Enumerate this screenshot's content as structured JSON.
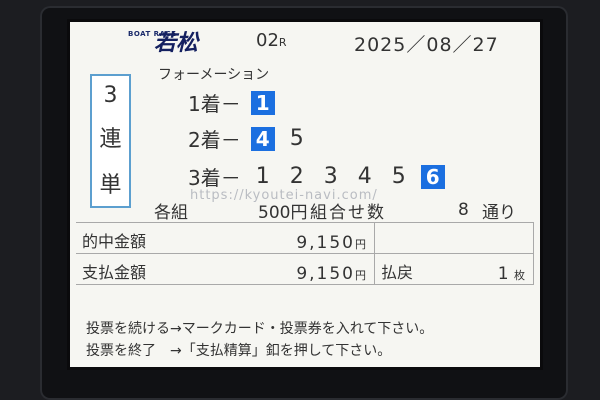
{
  "header": {
    "logo_small": "BOAT RACE",
    "venue": "若松",
    "race_no": "02",
    "race_suffix": "R",
    "date": "2025／08／27"
  },
  "bet": {
    "type_chars": [
      "3",
      "連",
      "単"
    ],
    "method": "フォーメーション",
    "first": {
      "label": "1着－",
      "selected": [
        "1"
      ],
      "plain": []
    },
    "second": {
      "label": "2着－",
      "selected": [
        "4"
      ],
      "plain": [
        "5"
      ]
    },
    "third": {
      "label": "3着－",
      "selected": [
        "6"
      ],
      "plain": [
        "1",
        "2",
        "3",
        "4",
        "5"
      ]
    },
    "per_line_label": "各組",
    "per_line_amount": "500円",
    "combo_label": "組合せ数",
    "combo_count": "8",
    "combo_unit": "通り"
  },
  "watermark": "https://kyoutei-navi.com/",
  "summary": {
    "hit_label": "的中金額",
    "hit_value": "9,150",
    "hit_unit": "円",
    "pay_label": "支払金額",
    "pay_value": "9,150",
    "pay_unit": "円",
    "refund_label": "払戻",
    "refund_value": "1",
    "refund_unit": "枚"
  },
  "messages": [
    "投票を続ける→マークカード・投票券を入れて下さい。",
    "投票を終了　→「支払精算」釦を押して下さい。"
  ]
}
